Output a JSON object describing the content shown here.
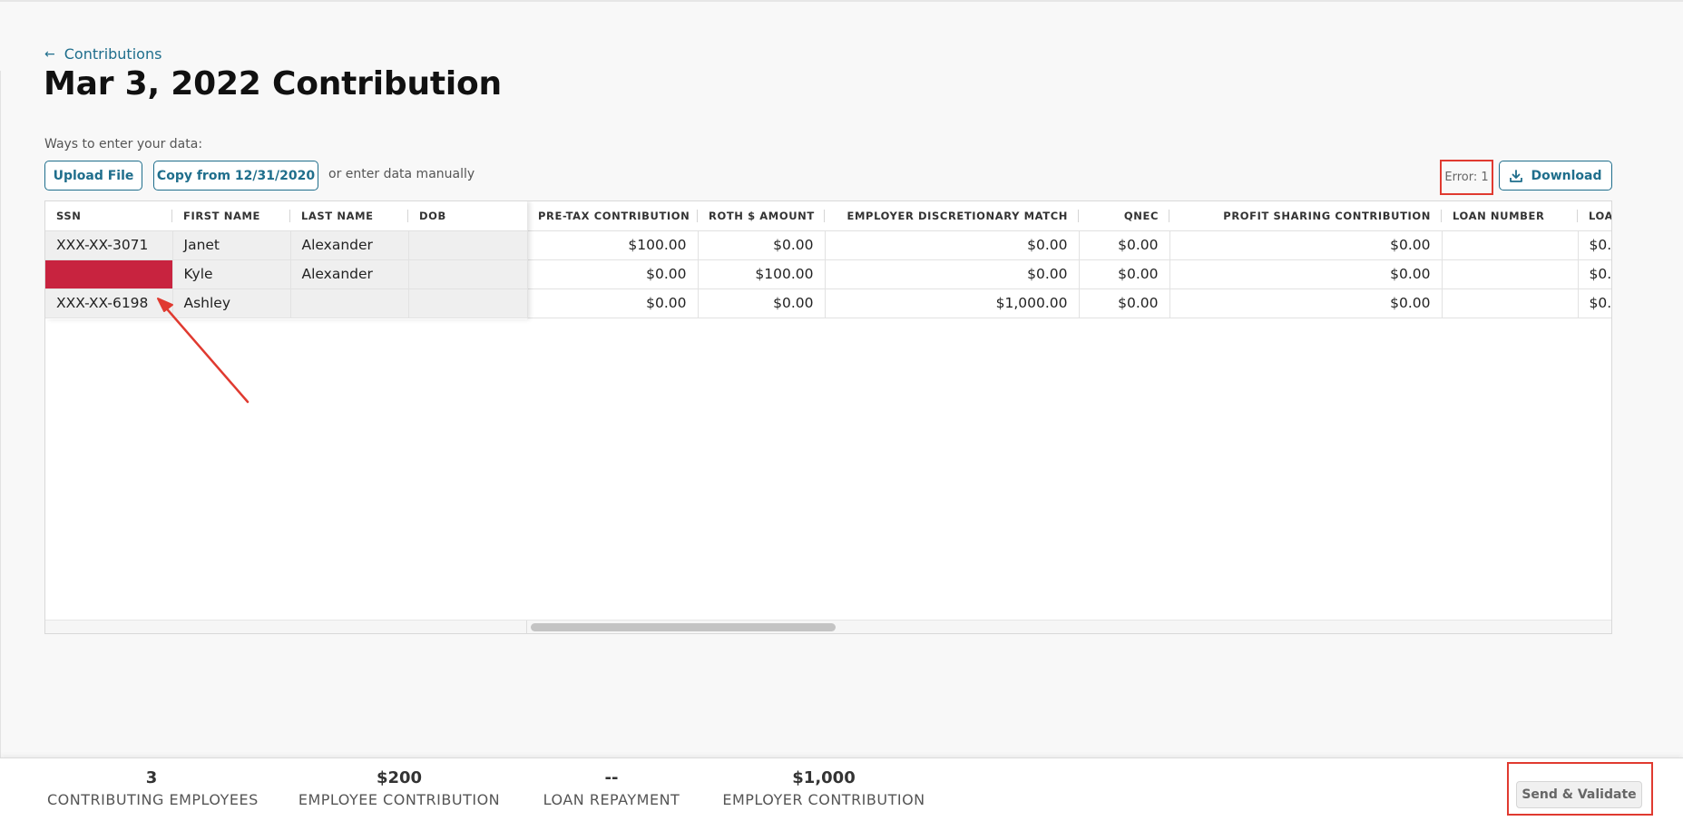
{
  "header": {
    "back_label": "Contributions",
    "title": "Mar 3, 2022 Contribution"
  },
  "data_entry": {
    "ways_label": "Ways to enter your data:",
    "upload_label": "Upload File",
    "copy_label": "Copy from 12/31/2020",
    "manual_text": "or enter data manually"
  },
  "toolbar": {
    "error_label": "Error: 1",
    "download_label": "Download"
  },
  "grid": {
    "frozen_columns": [
      "SSN",
      "FIRST NAME",
      "LAST NAME",
      "DOB"
    ],
    "scroll_columns": [
      "PRE-TAX CONTRIBUTION",
      "ROTH $ AMOUNT",
      "EMPLOYER DISCRETIONARY MATCH",
      "QNEC",
      "PROFIT SHARING CONTRIBUTION",
      "LOAN NUMBER",
      "LOA"
    ],
    "rows": [
      {
        "ssn": "XXX-XX-3071",
        "first_name": "Janet",
        "last_name": "Alexander",
        "dob": "",
        "pretax": "$100.00",
        "roth": "$0.00",
        "match": "$0.00",
        "qnec": "$0.00",
        "profit": "$0.00",
        "loan_number": "",
        "loan": "$0.0"
      },
      {
        "ssn": "",
        "first_name": "Kyle",
        "last_name": "Alexander",
        "dob": "",
        "pretax": "$0.00",
        "roth": "$100.00",
        "match": "$0.00",
        "qnec": "$0.00",
        "profit": "$0.00",
        "loan_number": "",
        "loan": "$0.0"
      },
      {
        "ssn": "XXX-XX-6198",
        "first_name": "Ashley",
        "last_name": "",
        "dob": "",
        "pretax": "$0.00",
        "roth": "$0.00",
        "match": "$1,000.00",
        "qnec": "$0.00",
        "profit": "$0.00",
        "loan_number": "",
        "loan": "$0.0"
      }
    ],
    "error_color": "#c8233f"
  },
  "footer": {
    "stats": [
      {
        "value": "3",
        "label": "CONTRIBUTING EMPLOYEES"
      },
      {
        "value": "$200",
        "label": "EMPLOYEE CONTRIBUTION"
      },
      {
        "value": "--",
        "label": "LOAN REPAYMENT"
      },
      {
        "value": "$1,000",
        "label": "EMPLOYER CONTRIBUTION"
      }
    ],
    "send_label": "Send & Validate"
  },
  "colors": {
    "accent": "#1f6e8c",
    "annotation": "#e03a30"
  }
}
